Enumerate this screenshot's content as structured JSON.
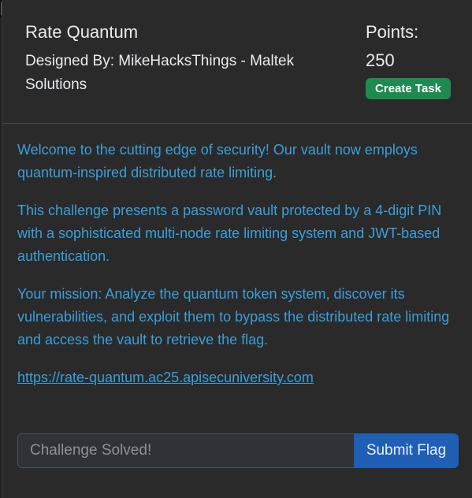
{
  "challenge": {
    "title": "Rate Quantum",
    "designer": "Designed By: MikeHacksThings - Maltek Solutions",
    "points_label": "Points:",
    "points_value": "250",
    "create_task_label": "Create Task"
  },
  "description": {
    "paragraphs": [
      "Welcome to the cutting edge of security! Our vault now employs quantum-inspired distributed rate limiting.",
      "This challenge presents a password vault protected by a 4-digit PIN with a sophisticated multi-node rate limiting system and JWT-based authentication.",
      "Your mission: Analyze the quantum token system, discover its vulnerabilities, and exploit them to bypass the distributed rate limiting and access the vault to retrieve the flag."
    ],
    "link": "https://rate-quantum.ac25.apisecuniversity.com"
  },
  "flag_form": {
    "placeholder": "Challenge Solved!",
    "submit_label": "Submit Flag"
  },
  "colors": {
    "accent_text": "#3a9fd8",
    "create_task_bg": "#1f8a4f",
    "submit_bg": "#1f5fb6"
  }
}
